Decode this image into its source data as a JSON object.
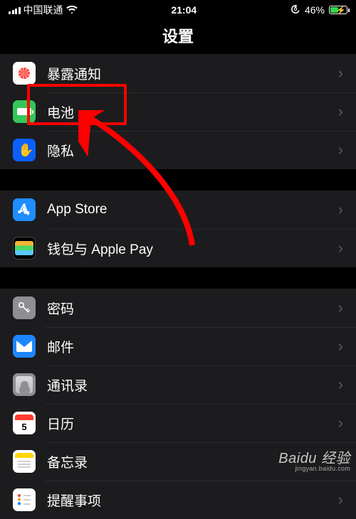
{
  "status": {
    "carrier": "中国联通",
    "time": "21:04",
    "battery_pct": "46%"
  },
  "nav": {
    "title": "设置"
  },
  "groups": [
    {
      "rows": [
        {
          "key": "exposure",
          "label": "暴露通知"
        },
        {
          "key": "battery",
          "label": "电池"
        },
        {
          "key": "privacy",
          "label": "隐私"
        }
      ]
    },
    {
      "rows": [
        {
          "key": "appstore",
          "label": "App Store"
        },
        {
          "key": "wallet",
          "label": "钱包与 Apple Pay"
        }
      ]
    },
    {
      "rows": [
        {
          "key": "password",
          "label": "密码"
        },
        {
          "key": "mail",
          "label": "邮件"
        },
        {
          "key": "contacts",
          "label": "通讯录"
        },
        {
          "key": "calendar",
          "label": "日历"
        },
        {
          "key": "notes",
          "label": "备忘录"
        },
        {
          "key": "reminders",
          "label": "提醒事项"
        }
      ]
    }
  ],
  "watermark": {
    "brand": "Baidu 经验",
    "url": "jingyan.baidu.com"
  },
  "annotation": {
    "highlighted_row": "battery"
  }
}
